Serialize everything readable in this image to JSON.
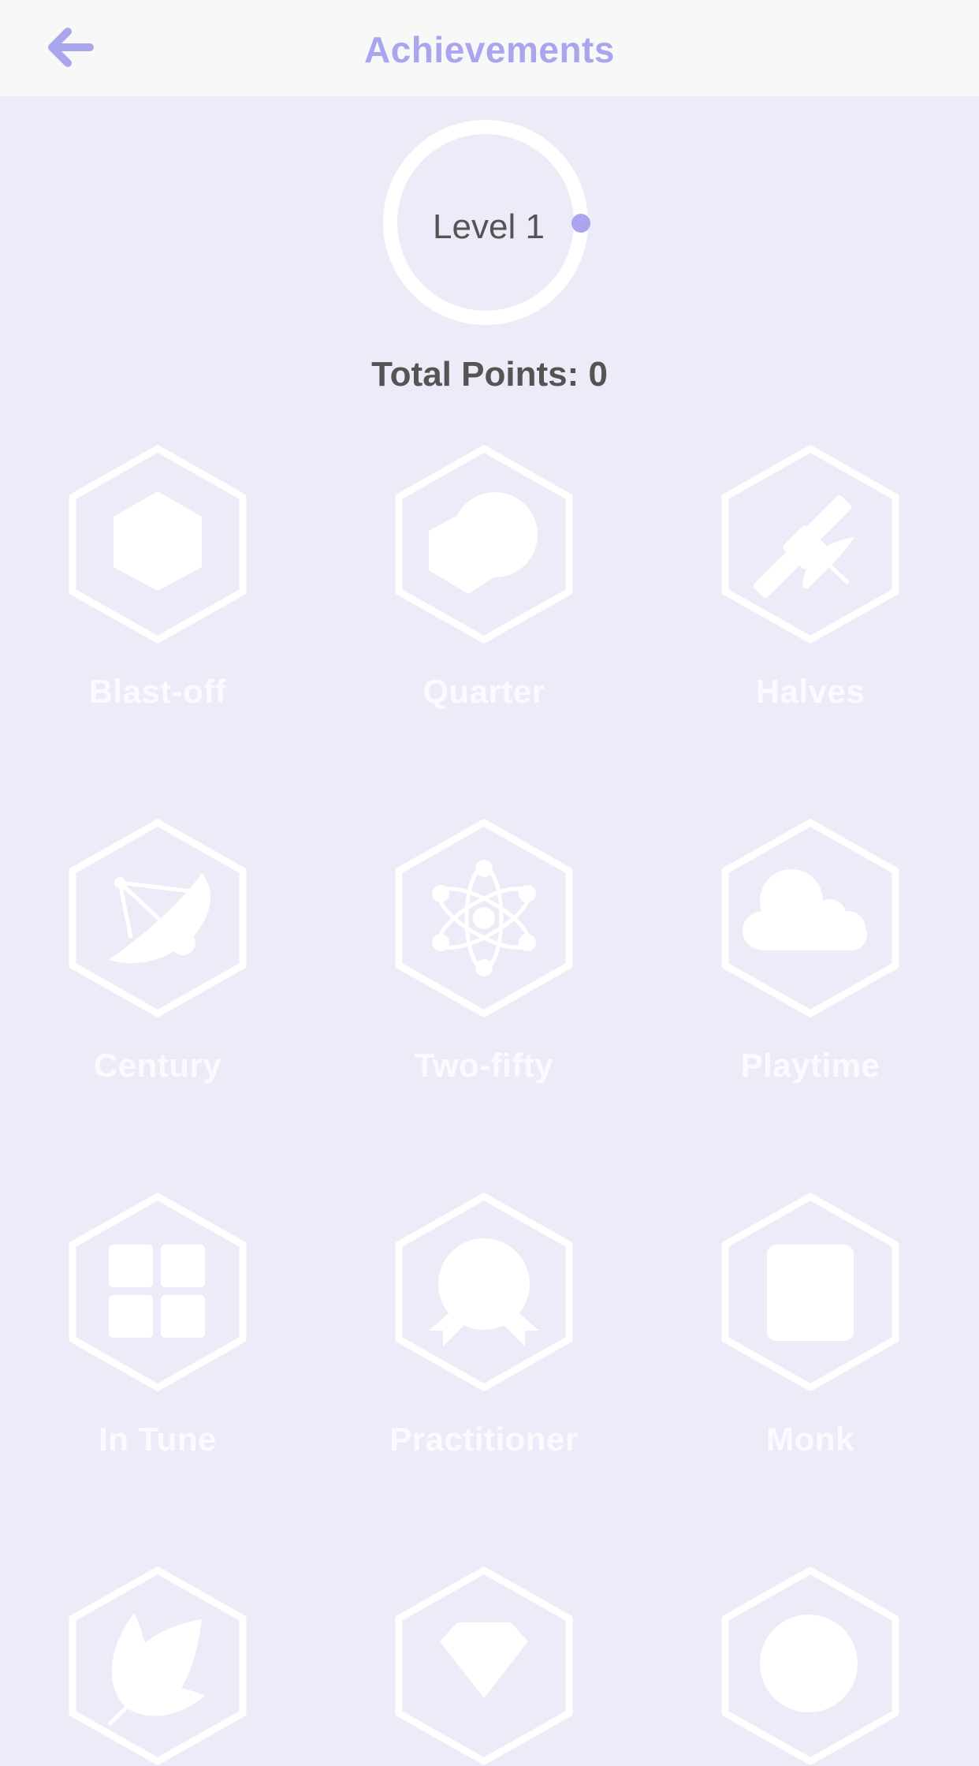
{
  "header": {
    "title": "Achievements",
    "back_icon": "arrow-left-icon"
  },
  "level": {
    "label": "Level 1"
  },
  "total_points": "Total Points: 0",
  "colors": {
    "accent": "#a9a6ee",
    "background": "#ebecf8",
    "header_background": "#f8f8f8",
    "badge_outline": "#ffffff",
    "text_dark": "#545454"
  },
  "badges": [
    {
      "label": "Blast-off",
      "icon": "cube-icon"
    },
    {
      "label": "Quarter",
      "icon": "pill-icon"
    },
    {
      "label": "Halves",
      "icon": "satellite-icon"
    },
    {
      "label": "Century",
      "icon": "satellite-dish-icon"
    },
    {
      "label": "Two-fifty",
      "icon": "atom-icon"
    },
    {
      "label": "Playtime",
      "icon": "cloud-icon"
    },
    {
      "label": "In Tune",
      "icon": "grid-icon"
    },
    {
      "label": "Practitioner",
      "icon": "rosette-icon"
    },
    {
      "label": "Monk",
      "icon": "square-icon"
    },
    {
      "label": "",
      "icon": "leaf-icon"
    },
    {
      "label": "",
      "icon": "diamond-icon"
    },
    {
      "label": "",
      "icon": "circle-icon"
    }
  ]
}
